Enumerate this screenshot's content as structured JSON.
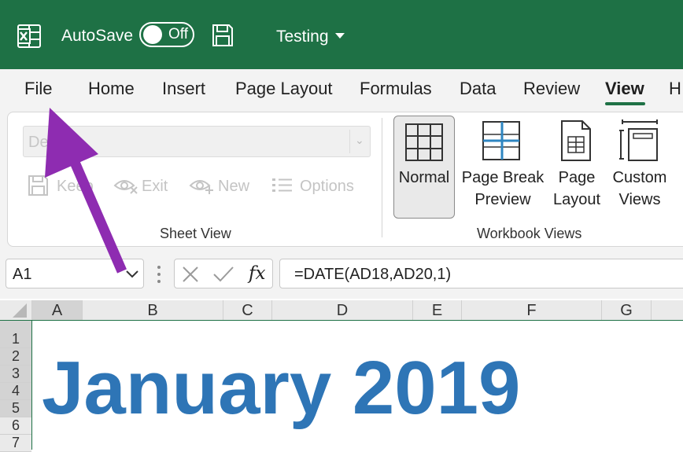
{
  "titlebar": {
    "autosave_label": "AutoSave",
    "toggle_state": "Off",
    "filename": "Testing"
  },
  "tabs": [
    "File",
    "Home",
    "Insert",
    "Page Layout",
    "Formulas",
    "Data",
    "Review",
    "View",
    "H"
  ],
  "active_tab": "View",
  "sheet_view": {
    "dropdown_value": "De",
    "keep_label": "Keep",
    "exit_label": "Exit",
    "new_label": "New",
    "options_label": "Options",
    "group_label": "Sheet View"
  },
  "workbook_views": {
    "normal_label": "Normal",
    "page_break_line1": "Page Break",
    "page_break_line2": "Preview",
    "page_layout_line1": "Page",
    "page_layout_line2": "Layout",
    "custom_views_line1": "Custom",
    "custom_views_line2": "Views",
    "group_label": "Workbook Views"
  },
  "formula_bar": {
    "name_box": "A1",
    "fx_label": "fx",
    "formula": "=DATE(AD18,AD20,1)"
  },
  "grid": {
    "columns": [
      "A",
      "B",
      "C",
      "D",
      "E",
      "F",
      "G"
    ],
    "rows": [
      "1",
      "2",
      "3",
      "4",
      "5",
      "6",
      "7"
    ],
    "cell_text": "January 2019"
  },
  "colors": {
    "titlebar": "#1e7145",
    "accent_green": "#1e7145",
    "cell_text": "#2e75b6",
    "arrow": "#8e2cb1"
  }
}
